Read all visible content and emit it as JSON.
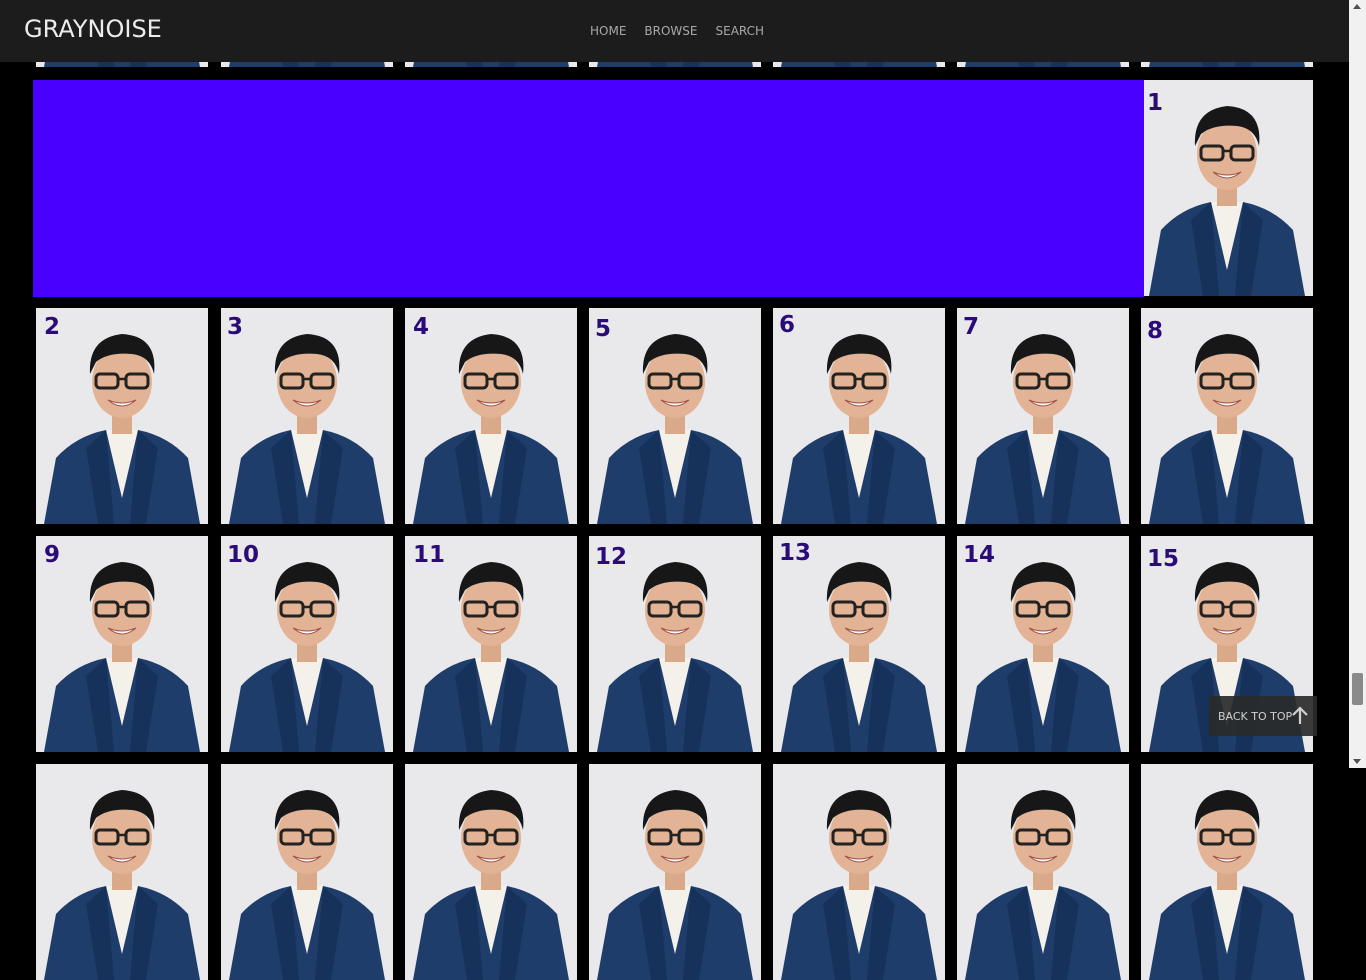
{
  "header": {
    "logo": "GRAYNOISE",
    "nav": [
      "HOME",
      "BROWSE",
      "SEARCH"
    ]
  },
  "grid": {
    "tile_numbers": [
      "1",
      "2",
      "3",
      "4",
      "5",
      "6",
      "7",
      "8",
      "9",
      "10",
      "11",
      "12",
      "13",
      "14",
      "15"
    ],
    "highlight_color": "#4a00ff",
    "number_color": "#2b0b78"
  },
  "back_to_top": {
    "label": "BACK TO TOP",
    "icon": "arrow-up-icon"
  }
}
